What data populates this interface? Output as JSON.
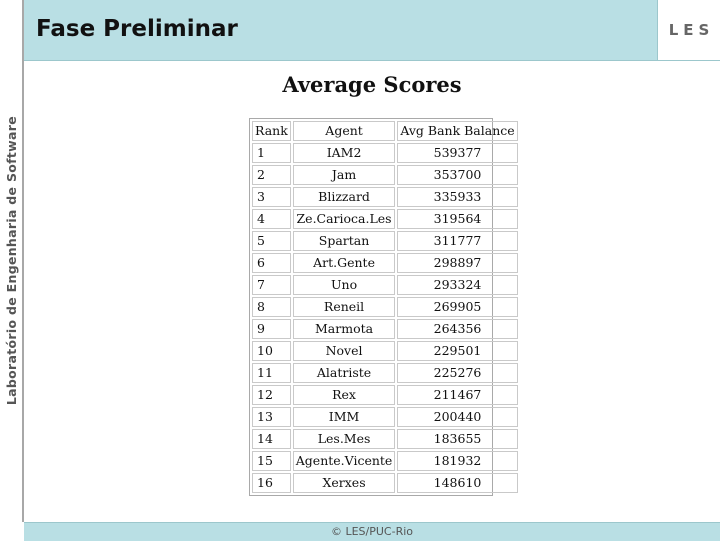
{
  "sidebar": {
    "text": "Laboratório de Engenharia de Software"
  },
  "header": {
    "title": "Fase Preliminar",
    "logo": "LES"
  },
  "main": {
    "heading": "Average Scores",
    "table": {
      "headers": [
        "Rank",
        "Agent",
        "Avg Bank Balance"
      ],
      "rows": [
        [
          "1",
          "IAM2",
          "539377"
        ],
        [
          "2",
          "Jam",
          "353700"
        ],
        [
          "3",
          "Blizzard",
          "335933"
        ],
        [
          "4",
          "Ze.Carioca.Les",
          "319564"
        ],
        [
          "5",
          "Spartan",
          "311777"
        ],
        [
          "6",
          "Art.Gente",
          "298897"
        ],
        [
          "7",
          "Uno",
          "293324"
        ],
        [
          "8",
          "Reneil",
          "269905"
        ],
        [
          "9",
          "Marmota",
          "264356"
        ],
        [
          "10",
          "Novel",
          "229501"
        ],
        [
          "11",
          "Alatriste",
          "225276"
        ],
        [
          "12",
          "Rex",
          "211467"
        ],
        [
          "13",
          "IMM",
          "200440"
        ],
        [
          "14",
          "Les.Mes",
          "183655"
        ],
        [
          "15",
          "Agente.Vicente",
          "181932"
        ],
        [
          "16",
          "Xerxes",
          "148610"
        ]
      ]
    }
  },
  "footer": {
    "text": "© LES/PUC-Rio"
  },
  "colors": {
    "accent": "#b9dfe4",
    "border": "#a8a8a8"
  }
}
